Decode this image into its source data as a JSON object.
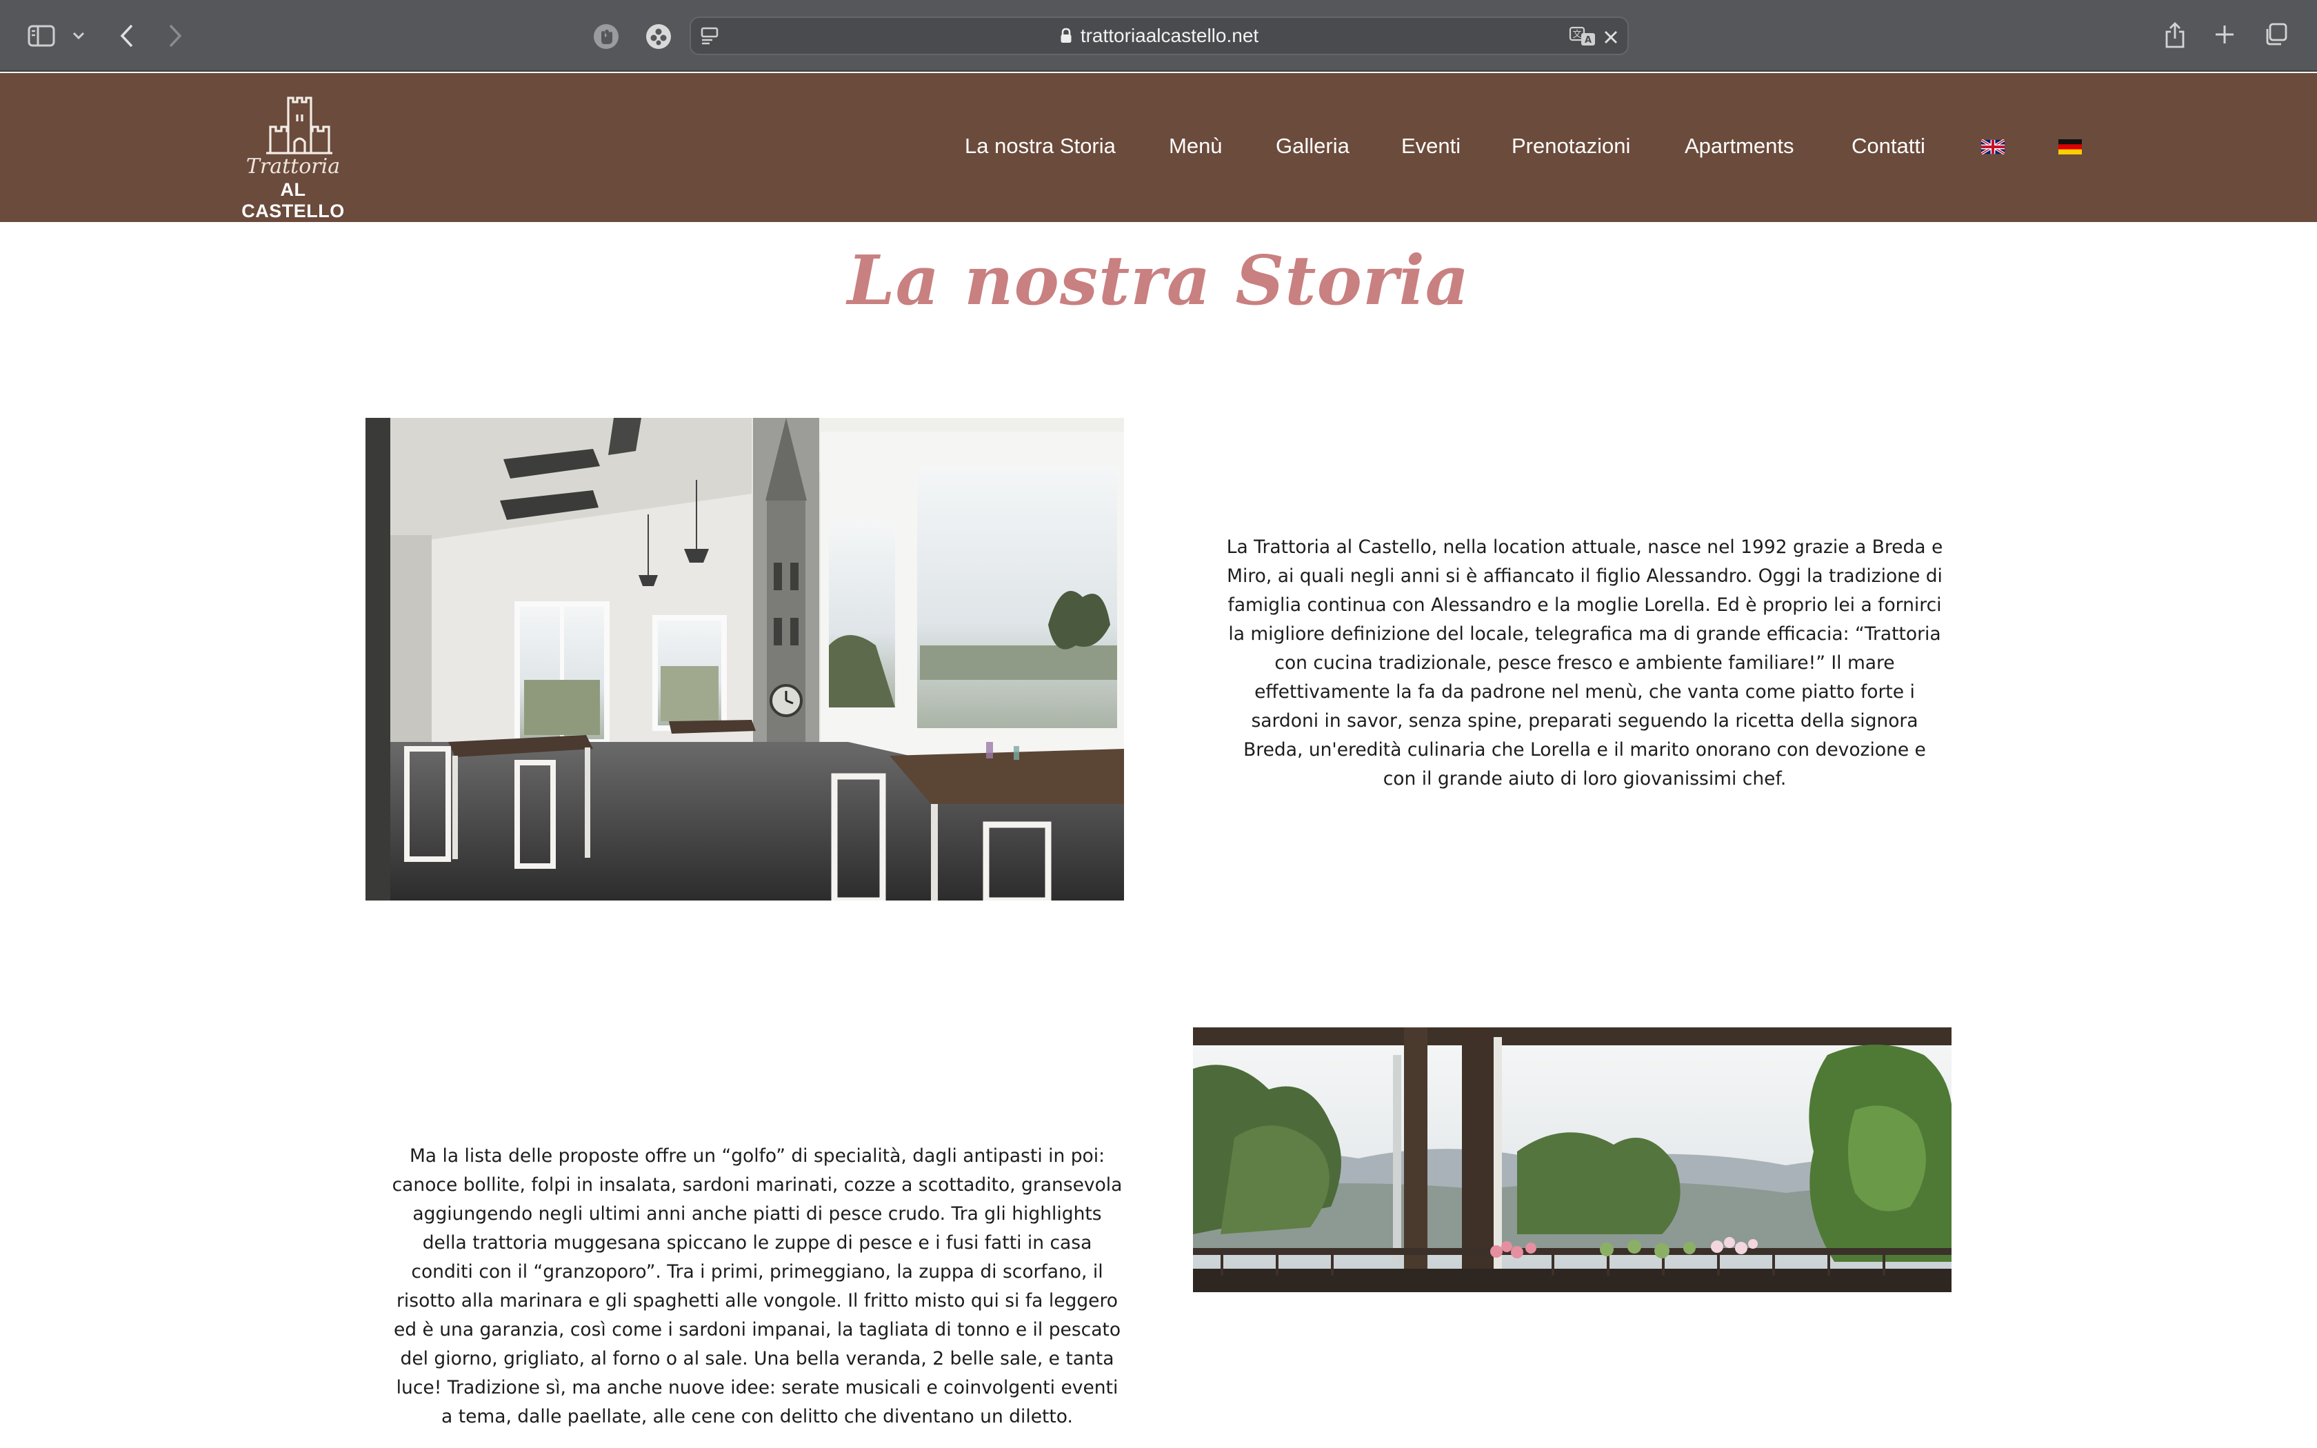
{
  "browser": {
    "url": "trattoriaalcastello.net"
  },
  "site": {
    "logo": {
      "script": "Trattoria",
      "brand": "AL CASTELLO"
    },
    "nav": [
      "La nostra Storia",
      "Menù",
      "Galleria",
      "Eventi",
      "Prenotazioni",
      "Apartments",
      "Contatti"
    ],
    "languages": [
      "english-flag",
      "german-flag"
    ]
  },
  "content": {
    "title": "La nostra Storia",
    "paragraph1": "La Trattoria al Castello, nella location attuale, nasce nel 1992 grazie a Breda e Miro, ai quali negli anni si è affiancato il figlio Alessandro. Oggi la tradizione di famiglia continua con Alessandro e la moglie Lorella. Ed è proprio lei a fornirci la migliore definizione del locale, telegrafica ma di grande efficacia: “Trattoria con cucina tradizionale, pesce fresco e ambiente familiare!” Il mare effettivamente la fa da padrone nel menù, che vanta come piatto forte i sardoni in savor, senza spine, preparati seguendo la ricetta della signora Breda, un'eredità culinaria che Lorella e il marito onorano con devozione e con il grande aiuto di loro giovanissimi chef.",
    "paragraph2": "Ma la lista delle proposte offre un “golfo” di specialità, dagli antipasti in poi: canoce bollite, folpi in insalata, sardoni marinati, cozze a scottadito, gransevola aggiungendo negli ultimi anni anche piatti di pesce crudo. Tra gli highlights della trattoria muggesana spiccano le zuppe di pesce e i fusi fatti in casa conditi con il “granzoporo”. Tra i primi, primeggiano, la zuppa di scorfano, il risotto alla marinara e gli spaghetti alle vongole. Il fritto misto qui si fa leggero ed è una garanzia, così come i sardoni impanai, la tagliata di tonno e il pescato del giorno, grigliato, al forno o al sale. Una bella veranda, 2 belle sale, e tanta luce! Tradizione sì, ma anche nuove idee: serate musicali e coinvolgenti eventi a tema, dalle paellate, alle cene con delitto che diventano un diletto."
  },
  "colors": {
    "chrome": "#56575b",
    "header": "#6b4b3c",
    "title": "#c98080"
  }
}
